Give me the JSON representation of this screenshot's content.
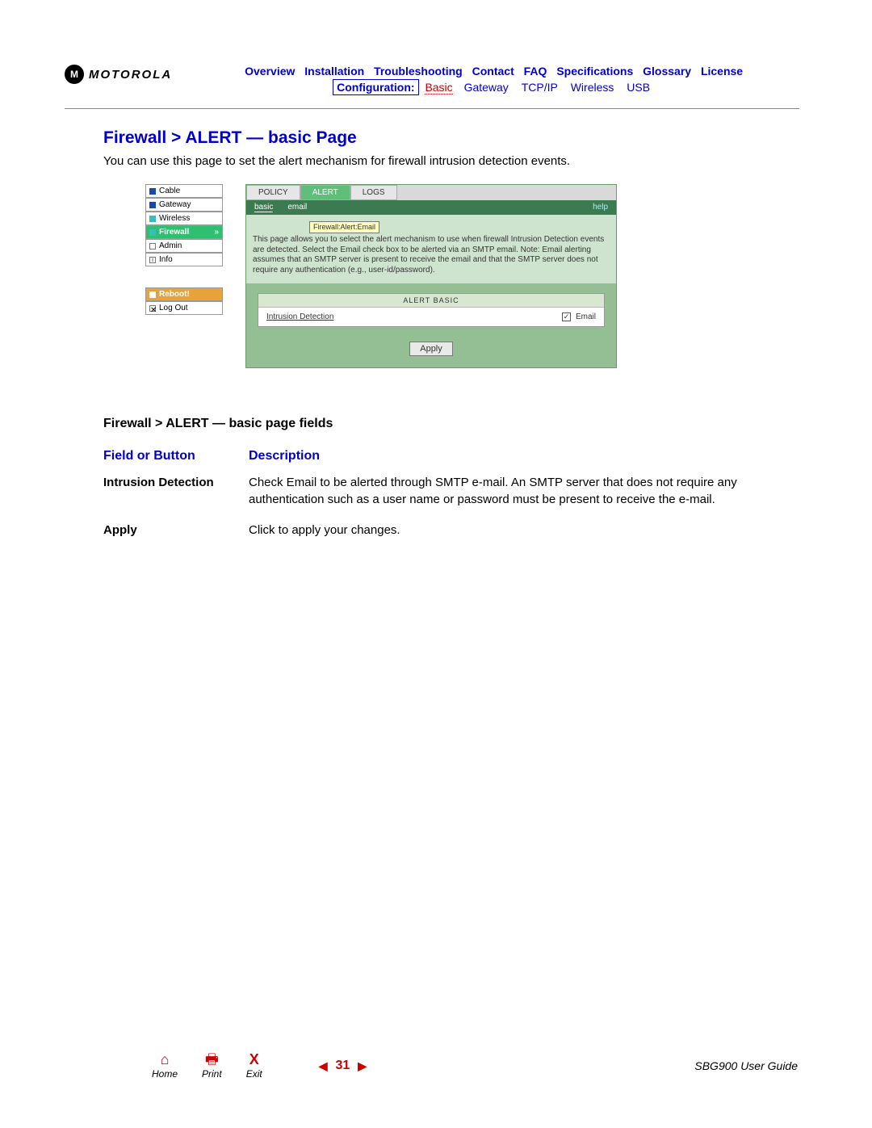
{
  "brand": "MOTOROLA",
  "nav": {
    "links": [
      "Overview",
      "Installation",
      "Troubleshooting",
      "Contact",
      "FAQ",
      "Specifications",
      "Glossary",
      "License"
    ],
    "config_label": "Configuration:",
    "sublinks": {
      "basic": "Basic",
      "gateway": "Gateway",
      "tcpip": "TCP/IP",
      "wireless": "Wireless",
      "usb": "USB"
    }
  },
  "title": "Firewall > ALERT — basic Page",
  "intro": "You can use this page to set the alert mechanism for firewall intrusion detection events.",
  "sidemenu": {
    "items": [
      "Cable",
      "Gateway",
      "Wireless",
      "Firewall",
      "Admin",
      "Info"
    ],
    "reboot": "Reboot!",
    "logout": "Log Out"
  },
  "panel": {
    "tabs": {
      "policy": "POLICY",
      "alert": "ALERT",
      "logs": "LOGS"
    },
    "subtabs": {
      "basic": "basic",
      "email": "email",
      "help": "help"
    },
    "tooltip": "Firewall:Alert:Email",
    "desc": "This page allows you to select the alert mechanism to use when firewall Intrusion Detection events are detected. Select the Email check box to be alerted via an SMTP email. Note: Email alerting assumes that an SMTP server is present to receive the email and that the SMTP server does not require any authentication (e.g., user-id/password).",
    "box_header": "ALERT BASIC",
    "row_label": "Intrusion Detection",
    "check_label": "Email",
    "apply": "Apply"
  },
  "fields": {
    "section_title": "Firewall > ALERT — basic page fields",
    "head_field": "Field or Button",
    "head_desc": "Description",
    "rows": [
      {
        "field": "Intrusion Detection",
        "desc": "Check Email to be alerted through SMTP e-mail. An SMTP server that does not require any authentication such as a user name or password must be present to receive the e-mail."
      },
      {
        "field": "Apply",
        "desc": "Click to apply your changes."
      }
    ]
  },
  "footer": {
    "home": "Home",
    "print": "Print",
    "exit": "Exit",
    "page": "31",
    "guide": "SBG900 User Guide"
  }
}
